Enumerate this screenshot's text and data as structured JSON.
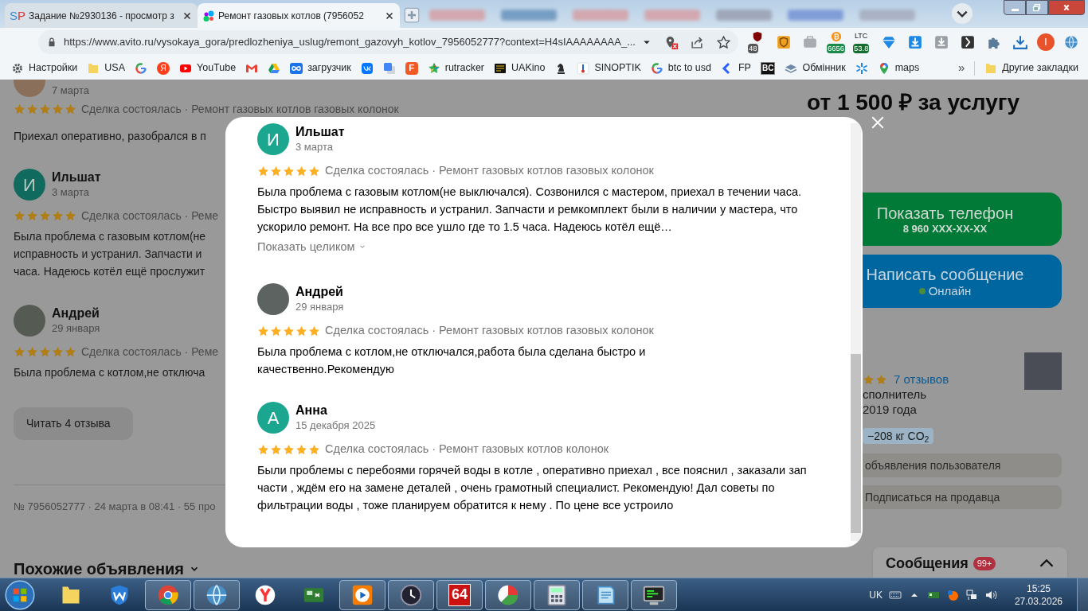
{
  "browser": {
    "tabs": [
      {
        "kind": "sp",
        "favicon_text": "SP",
        "title": "Задание №2930136 - просмотр з",
        "selected": false
      },
      {
        "kind": "avito",
        "title": "Ремонт газовых котлов (7956052",
        "selected": true
      }
    ],
    "url": "https://www.avito.ru/vysokaya_gora/predlozheniya_uslug/remont_gazovyh_kotlov_7956052777?context=H4sIAAAAAAAA_...",
    "extensions": [
      {
        "kind": "ublock",
        "badge": "48"
      },
      {
        "kind": "shield"
      },
      {
        "kind": "briefcase"
      },
      {
        "kind": "bitcoin",
        "badge": "6656"
      },
      {
        "kind": "ltc",
        "label": "LTC",
        "badge": "53.8"
      },
      {
        "kind": "diamond"
      },
      {
        "kind": "download-blue"
      },
      {
        "kind": "download-grey"
      },
      {
        "kind": "dark"
      },
      {
        "kind": "puzzle"
      },
      {
        "kind": "download"
      },
      {
        "kind": "profile",
        "label": "I"
      },
      {
        "kind": "globe"
      }
    ],
    "bookmarks": [
      {
        "kind": "gear",
        "label": "Настройки"
      },
      {
        "kind": "folder",
        "label": "USA"
      },
      {
        "kind": "google"
      },
      {
        "kind": "yandex",
        "glyph": "Я"
      },
      {
        "kind": "youtube",
        "label": "YouTube"
      },
      {
        "kind": "gmail"
      },
      {
        "kind": "drive"
      },
      {
        "kind": "infinity",
        "label": "загрузчик"
      },
      {
        "kind": "vk"
      },
      {
        "kind": "translate"
      },
      {
        "kind": "f-square",
        "glyph": "F"
      },
      {
        "kind": "star-multicolor",
        "label": "rutracker"
      },
      {
        "kind": "film",
        "label": "UAKino"
      },
      {
        "kind": "knight"
      },
      {
        "kind": "thermometer",
        "label": "SINOPTIK"
      },
      {
        "kind": "google",
        "label": "btc to usd"
      },
      {
        "kind": "chevron",
        "label": "FP"
      },
      {
        "kind": "bc",
        "glyph": "BC"
      },
      {
        "kind": "layers",
        "label": "Обмінник"
      },
      {
        "kind": "asterisk"
      },
      {
        "kind": "map-pin",
        "label": "maps"
      }
    ],
    "more": "»",
    "other_bookmarks": "Другие закладки"
  },
  "page": {
    "left_reviews": [
      {
        "kind": "photo",
        "date": "7 марта",
        "stars": 5,
        "deal": "Сделка состоялась · Ремонт газовых котлов газовых колонок",
        "text_lines": [
          "Приехал оперативно, разобрался в п"
        ]
      },
      {
        "kind": "letter",
        "initial": "И",
        "name": "Ильшат",
        "date": "3 марта",
        "stars": 5,
        "deal": "Сделка состоялась · Реме",
        "text_lines": [
          "Была проблема с газовым котлом(не",
          "исправность и устранил. Запчасти и",
          "часа. Надеюсь котёл ещё прослужит"
        ]
      },
      {
        "kind": "photo",
        "name": "Андрей",
        "date": "29 января",
        "stars": 5,
        "deal": "Сделка состоялась · Реме",
        "text_lines": [
          "Была проблема с котлом,не отключа"
        ]
      }
    ],
    "read_more_button": "Читать 4 отзыва",
    "meta": "№ 7956052777 · 24 марта в 08:41 · 55 про",
    "similar_heading": "Похожие объявления",
    "price": "от 1 500 ₽ за услугу",
    "phone_button": {
      "label": "Показать телефон",
      "sub": "8 960 XXX-XX-XX"
    },
    "message_button": {
      "label": "Написать сообщение",
      "status": "Онлайн",
      "online": true
    },
    "seller": {
      "reviews_link": "7 отзывов",
      "role": "сполнитель",
      "since": "2019 года",
      "eco_badge": "−208 кг CO$_{2}$"
    },
    "seller_actions": [
      "объявления пользователя",
      "Подписаться на продавца"
    ],
    "messages": {
      "label": "Сообщения",
      "badge": "99+"
    }
  },
  "modal": {
    "reviews": [
      {
        "kind": "letter",
        "initial": "И",
        "name": "Ильшат",
        "date": "3 марта",
        "stars": 5,
        "deal": "Сделка состоялась · Ремонт газовых котлов газовых колонок",
        "text": "Была проблема с газовым котлом(не выключался). Созвонился с мастером, приехал в течении часа. Быстро выявил не исправность и устранил. Запчасти и ремкомплект были в наличии у мастера, что ускорило ремонт. На все про все ушло где то 1.5 часа. Надеюсь котёл ещё…",
        "show_more": "Показать целиком"
      },
      {
        "kind": "photo",
        "name": "Андрей",
        "date": "29 января",
        "stars": 5,
        "deal": "Сделка состоялась · Ремонт газовых котлов газовых колонок",
        "text": "Была проблема с котлом,не отключался,работа была сделана быстро и\nкачественно.Рекомендую"
      },
      {
        "kind": "letter",
        "initial": "А",
        "name": "Анна",
        "date": "15 декабря 2025",
        "stars": 5,
        "deal": "Сделка состоялась · Ремонт газовых котлов колонок",
        "text": "Были проблемы с перебоями горячей воды в котле , оперативно приехал , все пояснил , заказали зап части , ждём его на замене деталей , очень грамотный специалист. Рекомендую! Дал советы по фильтрации воды , тоже планируем обратится к нему . По цене все устроило"
      }
    ]
  },
  "taskbar": {
    "apps": [
      {
        "kind": "folder",
        "running": false
      },
      {
        "kind": "w-shield",
        "running": false
      },
      {
        "kind": "chrome",
        "running": true
      },
      {
        "kind": "globe",
        "running": true
      },
      {
        "kind": "yandex",
        "running": false
      },
      {
        "kind": "card",
        "running": false
      },
      {
        "kind": "media",
        "running": true
      },
      {
        "kind": "clock",
        "running": true
      },
      {
        "kind": "sixty-four",
        "glyph": "64",
        "running": true
      },
      {
        "kind": "pie",
        "running": true
      },
      {
        "kind": "calculator",
        "running": true
      },
      {
        "kind": "notepad",
        "running": true
      },
      {
        "kind": "terminal",
        "running": true
      }
    ],
    "language": "UK",
    "time": "15:25",
    "date": "27.03.2026"
  }
}
